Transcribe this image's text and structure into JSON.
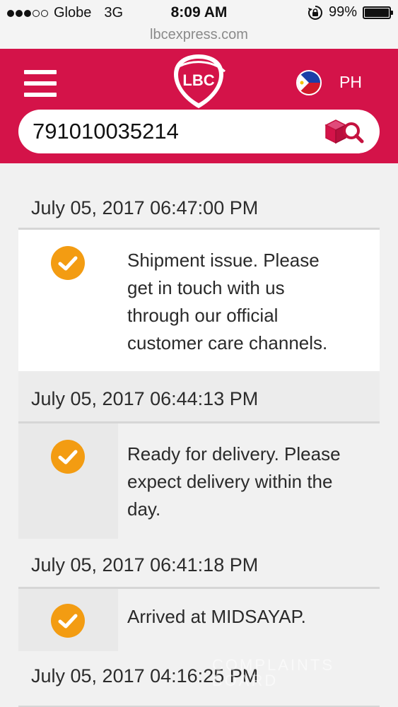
{
  "status_bar": {
    "carrier": "Globe",
    "network": "3G",
    "time": "8:09 AM",
    "battery": "99%",
    "battery_level": 0.99
  },
  "browser": {
    "url": "lbcexpress.com"
  },
  "header": {
    "brand_color": "#d41349",
    "logo_text": "LBC",
    "country": "PH",
    "tracking_number": "791010035214"
  },
  "tracking": {
    "accent_color": "#f39c12",
    "entries": [
      {
        "date": "July 05, 2017 06:47:00 PM",
        "message": "Shipment issue. Please get in touch with us through our official customer care channels."
      },
      {
        "date": "July 05, 2017 06:44:13 PM",
        "message": "Ready for delivery. Please expect delivery within the day."
      },
      {
        "date": "July 05, 2017 06:41:18 PM",
        "message": "Arrived at MIDSAYAP."
      },
      {
        "date": "July 05, 2017 04:16:25 PM",
        "message": ""
      }
    ]
  },
  "watermark": {
    "text": "COMPLAINTS BOARD"
  }
}
